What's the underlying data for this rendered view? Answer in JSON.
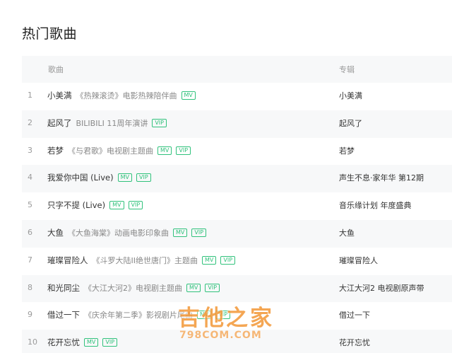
{
  "page": {
    "title": "热门歌曲"
  },
  "table": {
    "headers": {
      "song": "歌曲",
      "album": "专辑"
    },
    "rows": [
      {
        "index": "1",
        "name": "小美满",
        "desc": "《热辣滚烫》电影热辣陪伴曲",
        "tags": [
          "MV"
        ],
        "album": "小美满"
      },
      {
        "index": "2",
        "name": "起风了",
        "desc": "BILIBILI 11周年演讲",
        "tags": [
          "VIP"
        ],
        "album": "起风了"
      },
      {
        "index": "3",
        "name": "若梦",
        "desc": "《与君歌》电视剧主题曲",
        "tags": [
          "MV",
          "VIP"
        ],
        "album": "若梦"
      },
      {
        "index": "4",
        "name": "我爱你中国 (Live)",
        "desc": "",
        "tags": [
          "MV",
          "VIP"
        ],
        "album": "声生不息·家年华 第12期"
      },
      {
        "index": "5",
        "name": "只字不提 (Live)",
        "desc": "",
        "tags": [
          "MV",
          "VIP"
        ],
        "album": "音乐缘计划 年度盛典"
      },
      {
        "index": "6",
        "name": "大鱼",
        "desc": "《大鱼海棠》动画电影印象曲",
        "tags": [
          "MV",
          "VIP"
        ],
        "album": "大鱼"
      },
      {
        "index": "7",
        "name": "璀璨冒险人",
        "desc": "《斗罗大陆II绝世唐门》主题曲",
        "tags": [
          "MV",
          "VIP"
        ],
        "album": "璀璨冒险人"
      },
      {
        "index": "8",
        "name": "和光同尘",
        "desc": "《大江大河2》电视剧主题曲",
        "tags": [
          "MV",
          "VIP"
        ],
        "album": "大江大河2 电视剧原声带"
      },
      {
        "index": "9",
        "name": "借过一下",
        "desc": "《庆余年第二季》影视剧片尾曲",
        "tags": [
          "MV",
          "VIP"
        ],
        "album": "借过一下"
      },
      {
        "index": "10",
        "name": "花开忘忧",
        "desc": "",
        "tags": [
          "MV",
          "VIP"
        ],
        "album": "花开忘忧"
      }
    ]
  },
  "watermark": {
    "cn": "吉他之家",
    "en": "798COM.COM"
  },
  "colors": {
    "tag": "#31c27c",
    "stripe": "#f7f8f9",
    "watermark": "#f39a3c"
  }
}
